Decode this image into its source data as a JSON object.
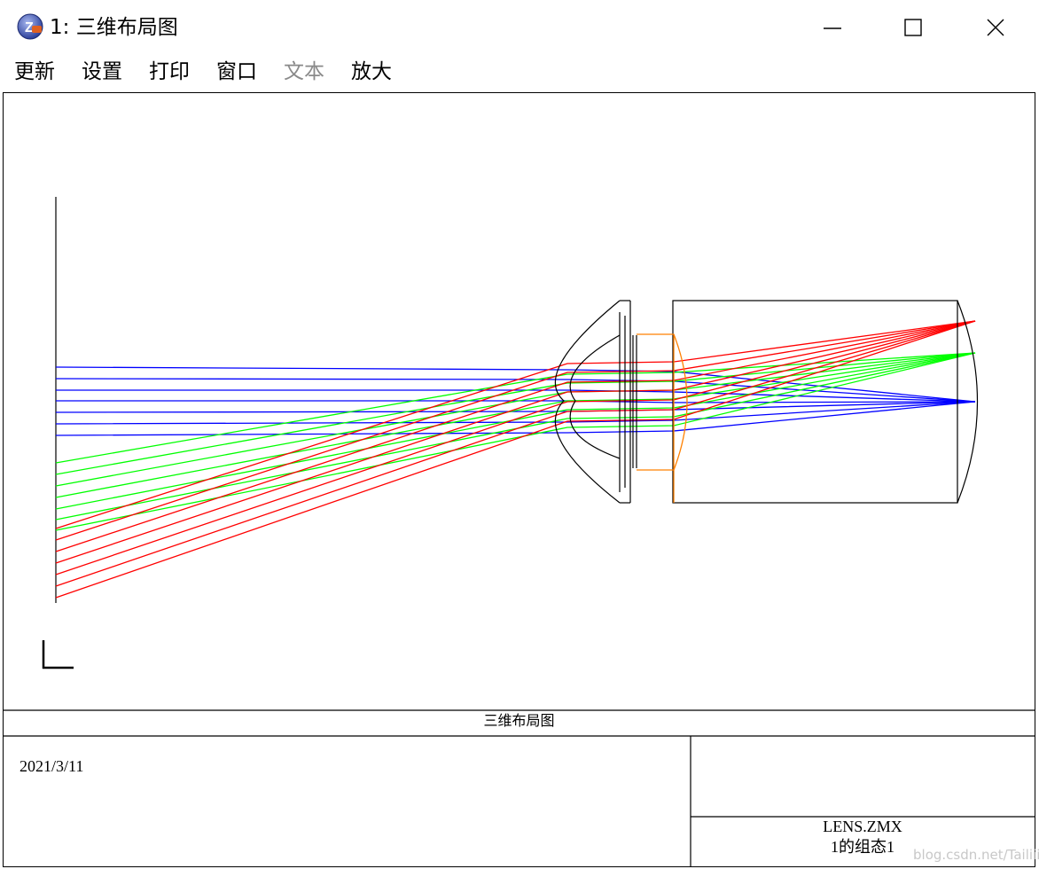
{
  "window": {
    "title": "1: 三维布局图",
    "icon": "zemax-app-icon"
  },
  "menu": [
    {
      "label": "更新",
      "enabled": true
    },
    {
      "label": "设置",
      "enabled": true
    },
    {
      "label": "打印",
      "enabled": true
    },
    {
      "label": "窗口",
      "enabled": true
    },
    {
      "label": "文本",
      "enabled": false
    },
    {
      "label": "放大",
      "enabled": true
    }
  ],
  "footer": {
    "plot_title": "三维布局图",
    "date": "2021/3/11",
    "file_name": "LENS.ZMX",
    "configuration": "1的组态1"
  },
  "watermark": "blog.csdn.net/Tailiii",
  "colors": {
    "field1": "#0000ff",
    "field2": "#00ff00",
    "field3": "#ff0000",
    "optic_outline": "#000000",
    "highlighted_lens": "#ff8000"
  },
  "icons": [
    "close-icon",
    "maximize-icon",
    "minimize-icon"
  ]
}
